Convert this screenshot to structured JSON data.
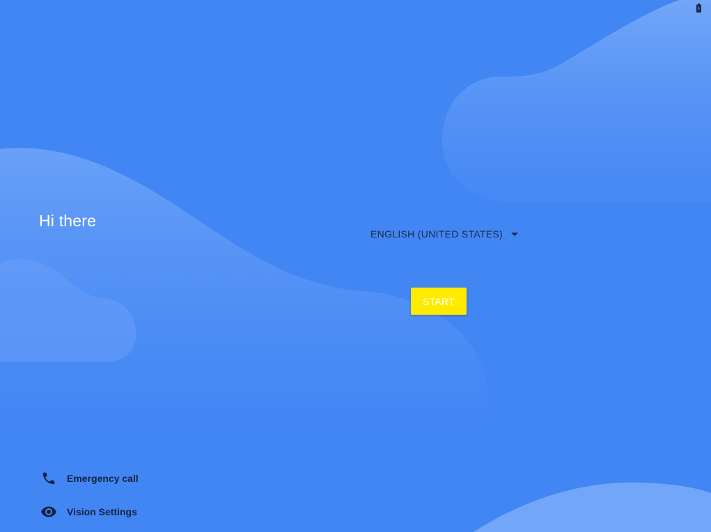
{
  "welcome": {
    "greeting": "Hi there"
  },
  "language": {
    "selected": "ENGLISH (UNITED STATES)",
    "icon": "dropdown-caret-icon"
  },
  "start_button": {
    "label": "START",
    "color": "#ffeb00"
  },
  "actions": {
    "emergency": {
      "label": "Emergency call",
      "icon": "phone-icon"
    },
    "vision": {
      "label": "Vision Settings",
      "icon": "eye-icon"
    }
  },
  "status_bar": {
    "battery_icon": "battery-charging-icon"
  },
  "colors": {
    "background": "#4286f4",
    "wave": "#6ea2f7",
    "text_dark": "#14233d"
  }
}
